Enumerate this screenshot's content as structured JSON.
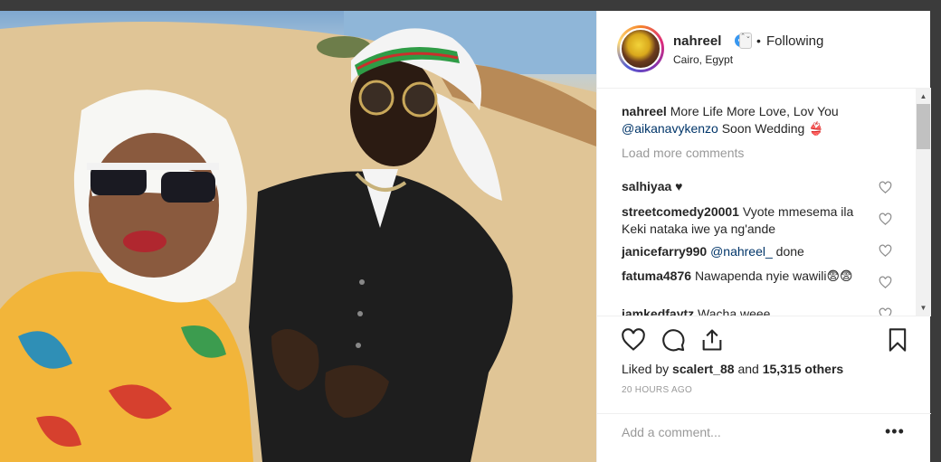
{
  "post": {
    "username": "nahreel",
    "verified_mark": "✔",
    "separator": "•",
    "follow_status": "Following",
    "location": "Cairo, Egypt"
  },
  "caption": {
    "username": "nahreel",
    "text_1": "More Life More Love, Lov You",
    "mention": "@aikanavykenzo",
    "text_2": "Soon Wedding 👙"
  },
  "load_more": "Load more comments",
  "comments": [
    {
      "user": "salhiyaa",
      "text": "♥"
    },
    {
      "user": "streetcomedy20001",
      "text": "Vyote mmesema ila Keki nataka iwe ya ng'ande"
    },
    {
      "user": "janicefarry990",
      "mention": "@nahreel_",
      "text": "done"
    },
    {
      "user": "fatuma4876",
      "text": "Nawapenda nyie wawili😨😨"
    },
    {
      "user": "iamkedfaytz",
      "text": "Wacha weee"
    }
  ],
  "likes": {
    "prefix": "Liked by",
    "user": "scalert_88",
    "middle": "and",
    "others": "15,315 others"
  },
  "timestamp": "20 HOURS AGO",
  "add_comment_placeholder": "Add a comment...",
  "more_label": "•••",
  "scroll": {
    "up": "▲",
    "down": "▼"
  },
  "chevron": "⌃⌄",
  "icons": {
    "like": "heart-icon",
    "comment": "comment-icon",
    "share": "share-icon",
    "save": "bookmark-icon",
    "comment_like": "heart-icon"
  },
  "colors": {
    "verified": "#3897f0",
    "mention": "#003569",
    "muted": "#999999",
    "text": "#262626"
  }
}
